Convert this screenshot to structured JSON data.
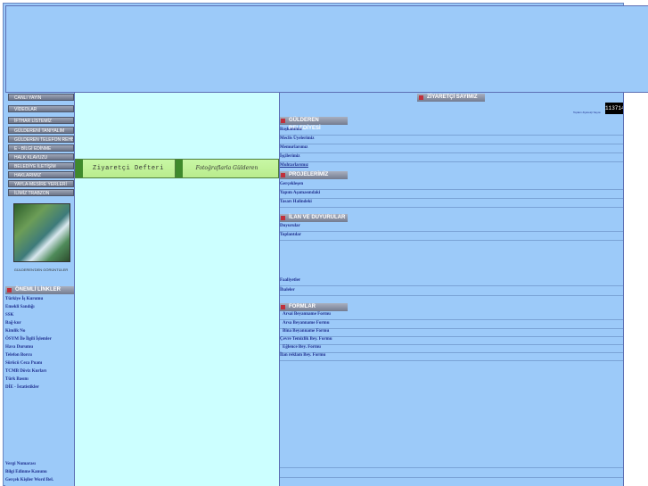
{
  "nav": {
    "buttons": [
      {
        "label": "CANLI YAYIN"
      },
      {
        "label": "VİDEOLAR"
      },
      {
        "label": "İFTHAR LİSTEMİZ"
      },
      {
        "label": "GÜLDERENİ TANIYALIM"
      },
      {
        "label": "GÜLDEREN TELEFON REHBERİ"
      },
      {
        "label": "E - BİLGİ EDİNME"
      },
      {
        "label": "HALK KLAVUZU"
      },
      {
        "label": "BELEDİYE İLETİŞİM"
      },
      {
        "label": "HAKLARIMIZ"
      },
      {
        "label": "YAYLA-MESİRE YERLERİ"
      },
      {
        "label": "İLİMİZ TRABZON"
      }
    ],
    "photo_caption": "GÜLDEREN'DEN GÖRÜNTÜLER"
  },
  "important_links": {
    "title": "ÖNEMLİ LİNKLER",
    "items": [
      "Türkiye İş Kurumu",
      "Emekli Sandığı",
      "SSK",
      "Bağ-kur",
      "Kimlik No",
      "ÖSYM İle İlgili İşlemler",
      "Hava Durumu",
      "Telefon Borcu",
      "Sürücü Ceza Puanı",
      "TCMB Döviz Kurları",
      "Türk Basını",
      "DİE - İstatistikler"
    ],
    "bottom_items": [
      "Vergi Numarası",
      "Bilgi Edinme Kanunu",
      "Gerçek Kişiler Word Bel."
    ]
  },
  "center": {
    "tab1": "Ziyaretçi Defteri",
    "tab2": "Fotoğraflarla Gülderen"
  },
  "visitor": {
    "title": "ZİYARETÇİ SAYIMIZ",
    "count": "113714",
    "label": "Toplam Ziyaretçi Sayısı"
  },
  "sections": {
    "belediye": {
      "title": "GÜLDEREN BELEDİYESİ",
      "items": [
        "Başkanımız",
        "Meclis Üyelerimiz",
        "Memurlarımız",
        "İşçilerimiz",
        "Muhtarlarımız"
      ]
    },
    "projeler": {
      "title": "PROJELERİMİZ",
      "items": [
        "Gerçekleşen",
        "Yapım Aşamasındaki",
        "Tasarı Halindeki"
      ]
    },
    "ilan": {
      "title": "İLAN VE DUYURULAR",
      "items": [
        "Duyurular",
        "Toplantılar"
      ],
      "lower_items": [
        "Faaliyetler",
        "İhaleler"
      ]
    },
    "formlar": {
      "title": "FORMLAR",
      "items": [
        "Arsai Beyanname Formu",
        "Arsa Beyanname Formu",
        "Bina Beyanname Formu",
        "Çevre Temizlik Bey. Formu",
        "Eğlence Bey. Formu",
        "İlan reklam Bey. Formu"
      ]
    }
  }
}
